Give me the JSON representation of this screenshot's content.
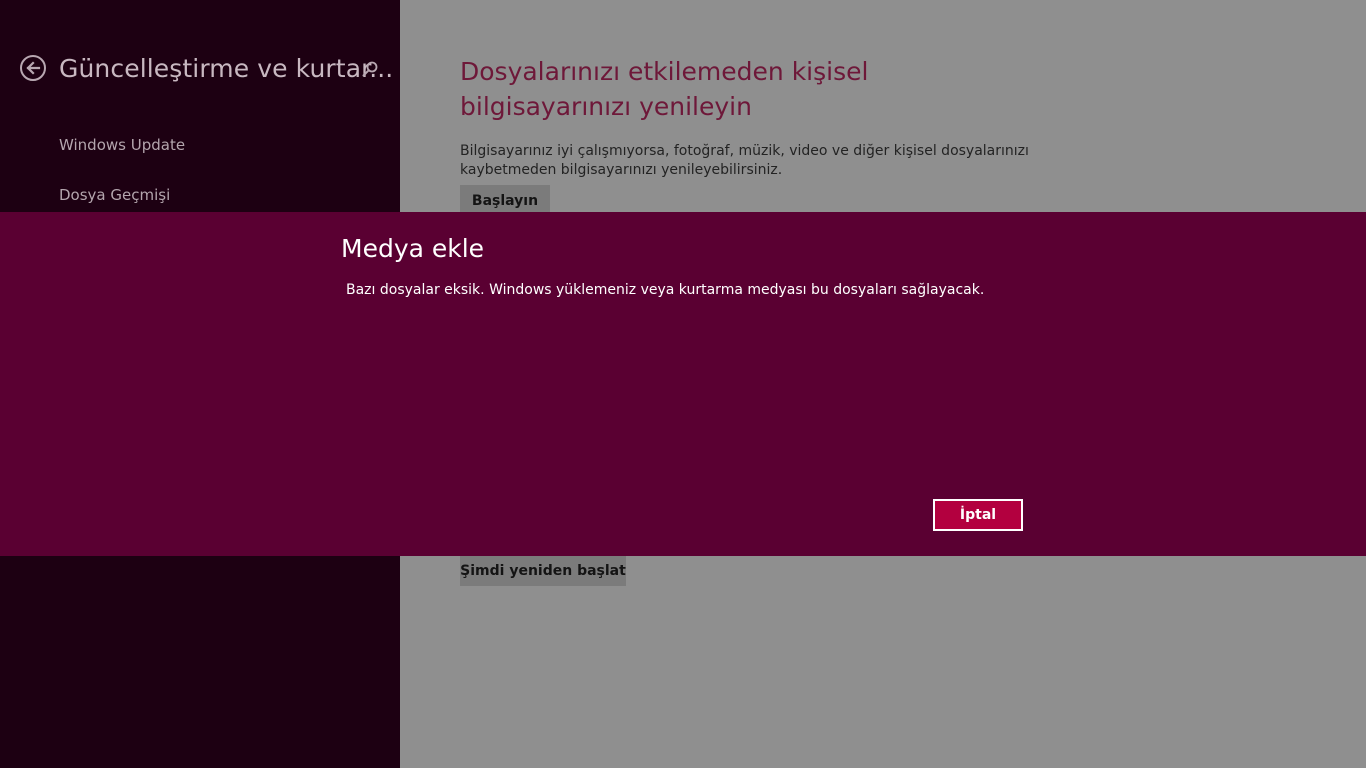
{
  "sidebar": {
    "title": "Güncelleştirme ve kurtar...",
    "back_icon": "back-arrow-icon",
    "search_icon": "search-icon",
    "items": [
      {
        "label": "Windows Update"
      },
      {
        "label": "Dosya Geçmişi"
      }
    ]
  },
  "main": {
    "refresh": {
      "heading": "Dosyalarınızı etkilemeden kişisel bilgisayarınızı yenileyin",
      "description": "Bilgisayarınız iyi çalışmıyorsa, fotoğraf, müzik, video ve diğer kişisel dosyalarınızı kaybetmeden bilgisayarınızı yenileyebilirsiniz.",
      "start_button": "Başlayın"
    },
    "restart_button": "Şimdi yeniden başlat"
  },
  "dialog": {
    "title": "Medya ekle",
    "message": "Bazı dosyalar eksik. Windows yüklemeniz veya kurtarma medyası bu dosyaları sağlayacak.",
    "cancel_button": "İptal"
  },
  "colors": {
    "sidebar_bg": "#1d0012",
    "dialog_bg": "#5a0032",
    "accent_button": "#b3003f",
    "heading_text": "#6e1839"
  }
}
